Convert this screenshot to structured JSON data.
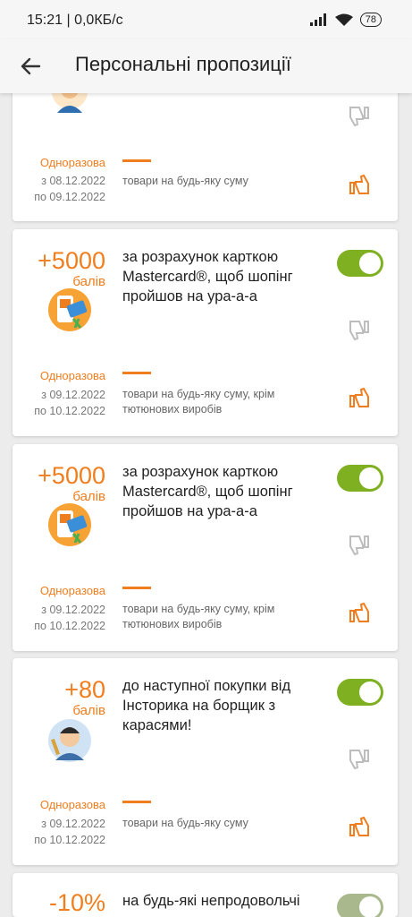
{
  "status": {
    "time": "15:21 | 0,0КБ/с",
    "battery": "78"
  },
  "header": {
    "title": "Персональні пропозиції"
  },
  "cards": [
    {
      "amount": "",
      "unit": "",
      "description": "",
      "frequency": "Одноразова",
      "date_from": "з 08.12.2022",
      "date_to": "по 09.12.2022",
      "scope": "товари на будь-яку суму",
      "toggle_on": true
    },
    {
      "amount": "+5000",
      "unit": "балів",
      "description": "за розрахунок карткою Mastercard®, щоб шопінг пройшов на ура-а-а",
      "frequency": "Одноразова",
      "date_from": "з 09.12.2022",
      "date_to": "по 10.12.2022",
      "scope": "товари на будь-яку суму, крім тютюнових виробів",
      "toggle_on": true
    },
    {
      "amount": "+5000",
      "unit": "балів",
      "description": "за розрахунок карткою Mastercard®, щоб шопінг пройшов на ура-а-а",
      "frequency": "Одноразова",
      "date_from": "з 09.12.2022",
      "date_to": "по 10.12.2022",
      "scope": "товари на будь-яку суму, крім тютюнових виробів",
      "toggle_on": true
    },
    {
      "amount": "+80",
      "unit": "балів",
      "description": "до наступної покупки від Інсторика на борщик з карасями!",
      "frequency": "Одноразова",
      "date_from": "з 09.12.2022",
      "date_to": "по 10.12.2022",
      "scope": "товари на будь-яку суму",
      "toggle_on": true
    },
    {
      "amount": "-10%",
      "unit": "",
      "description": "на будь-які непродовольчі",
      "toggle_on": true
    }
  ],
  "colors": {
    "accent": "#f07e1e",
    "toggle": "#7fb022"
  }
}
